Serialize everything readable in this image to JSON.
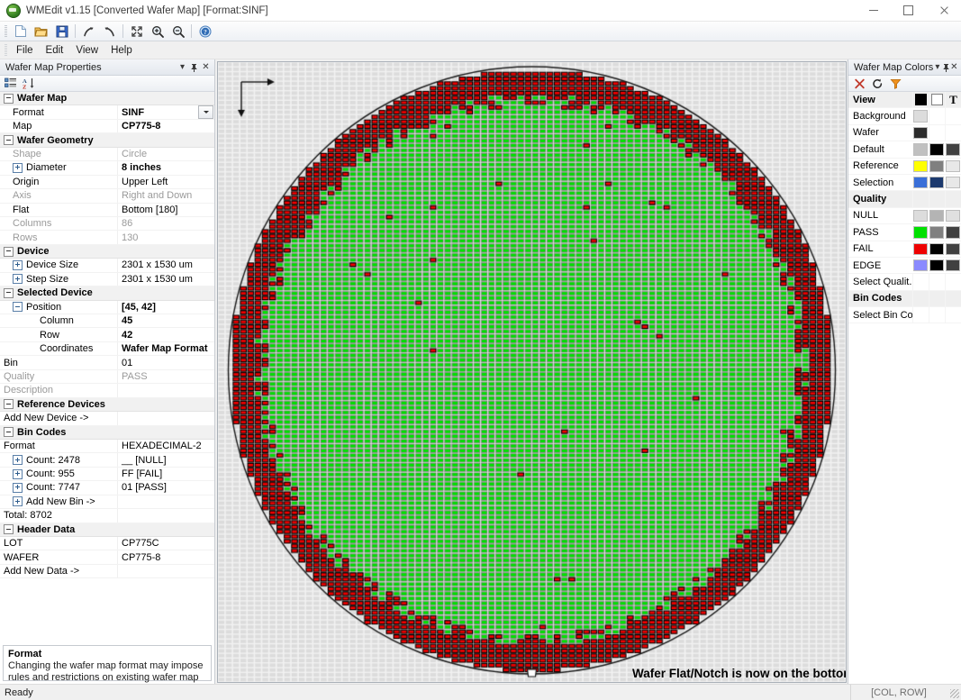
{
  "window": {
    "title": "WMEdit v1.15 [Converted Wafer Map] [Format:SINF]",
    "app_icon": "wafer-app-icon",
    "minimize": "minimize-icon",
    "maximize": "maximize-icon",
    "close": "close-icon"
  },
  "toolbar": {
    "items": [
      {
        "name": "new-file-icon",
        "label": "New"
      },
      {
        "name": "open-folder-icon",
        "label": "Open"
      },
      {
        "name": "save-icon",
        "label": "Save"
      },
      {
        "name": "redo-icon",
        "label": "Redo"
      },
      {
        "name": "undo-icon",
        "label": "Undo"
      },
      {
        "name": "fit-to-window-icon",
        "label": "Fit"
      },
      {
        "name": "zoom-in-icon",
        "label": "Zoom In"
      },
      {
        "name": "zoom-out-icon",
        "label": "Zoom Out"
      },
      {
        "name": "help-icon",
        "label": "Help"
      }
    ]
  },
  "menubar": {
    "items": [
      "File",
      "Edit",
      "View",
      "Help"
    ]
  },
  "properties_panel": {
    "title": "Wafer Map Properties",
    "header_buttons": [
      "dropdown-icon",
      "pin-icon",
      "close-icon"
    ],
    "toolbar_buttons": [
      "categorized-sort-icon",
      "alphabetical-sort-icon"
    ],
    "rows": [
      {
        "kind": "category",
        "name": "Wafer Map",
        "value": "",
        "indent": 0,
        "expander": "minus"
      },
      {
        "kind": "prop",
        "name": "Format",
        "value": "SINF",
        "indent": 1,
        "bold": true,
        "combo": true
      },
      {
        "kind": "prop",
        "name": "Map",
        "value": "CP775-8",
        "indent": 1,
        "bold": true
      },
      {
        "kind": "category",
        "name": "Wafer Geometry",
        "value": "",
        "indent": 0,
        "expander": "minus"
      },
      {
        "kind": "prop",
        "name": "Shape",
        "value": "Circle",
        "indent": 1,
        "dim": true
      },
      {
        "kind": "prop",
        "name": "Diameter",
        "value": "8 inches",
        "indent": 1,
        "bold": true,
        "expander": "plus-blue"
      },
      {
        "kind": "prop",
        "name": "Origin",
        "value": "Upper Left",
        "indent": 1
      },
      {
        "kind": "prop",
        "name": "Axis",
        "value": "Right and Down",
        "indent": 1,
        "dim": true
      },
      {
        "kind": "prop",
        "name": "Flat",
        "value": "Bottom [180]",
        "indent": 1
      },
      {
        "kind": "prop",
        "name": "Columns",
        "value": "86",
        "indent": 1,
        "dim": true
      },
      {
        "kind": "prop",
        "name": "Rows",
        "value": "130",
        "indent": 1,
        "dim": true
      },
      {
        "kind": "category",
        "name": "Device",
        "value": "",
        "indent": 0,
        "expander": "minus"
      },
      {
        "kind": "prop",
        "name": "Device Size",
        "value": "2301 x 1530 um",
        "indent": 1,
        "expander": "plus-blue"
      },
      {
        "kind": "prop",
        "name": "Step Size",
        "value": "2301 x 1530 um",
        "indent": 1,
        "expander": "plus-blue"
      },
      {
        "kind": "category",
        "name": "Selected Device",
        "value": "",
        "indent": 0,
        "expander": "minus"
      },
      {
        "kind": "prop",
        "name": "Position",
        "value": "[45, 42]",
        "indent": 1,
        "bold": true,
        "expander": "minus-blue"
      },
      {
        "kind": "prop",
        "name": "Column",
        "value": "45",
        "indent": 3,
        "bold": true
      },
      {
        "kind": "prop",
        "name": "Row",
        "value": "42",
        "indent": 3,
        "bold": true
      },
      {
        "kind": "prop",
        "name": "Coordinates",
        "value": "Wafer Map Format",
        "indent": 3,
        "bold": true
      },
      {
        "kind": "prop",
        "name": "Bin",
        "value": "01",
        "indent": 0
      },
      {
        "kind": "prop",
        "name": "Quality",
        "value": "PASS",
        "indent": 0,
        "dim": true
      },
      {
        "kind": "prop",
        "name": "Description",
        "value": "",
        "indent": 0,
        "dim": true
      },
      {
        "kind": "category",
        "name": "Reference Devices",
        "value": "",
        "indent": 0,
        "expander": "minus"
      },
      {
        "kind": "prop",
        "name": "Add New Device ->",
        "value": "",
        "indent": 0
      },
      {
        "kind": "category",
        "name": "Bin Codes",
        "value": "",
        "indent": 0,
        "expander": "minus"
      },
      {
        "kind": "prop",
        "name": "Format",
        "value": "HEXADECIMAL-2",
        "indent": 0
      },
      {
        "kind": "prop",
        "name": "Count: 2478",
        "value": "__ [NULL]",
        "indent": 1,
        "expander": "plus-blue"
      },
      {
        "kind": "prop",
        "name": "Count: 955",
        "value": "FF [FAIL]",
        "indent": 1,
        "expander": "plus-blue"
      },
      {
        "kind": "prop",
        "name": "Count: 7747",
        "value": "01 [PASS]",
        "indent": 1,
        "expander": "plus-blue"
      },
      {
        "kind": "prop",
        "name": "Add New Bin ->",
        "value": "",
        "indent": 1,
        "expander": "plus-blue"
      },
      {
        "kind": "prop",
        "name": "Total: 8702",
        "value": "",
        "indent": 0
      },
      {
        "kind": "category",
        "name": "Header Data",
        "value": "",
        "indent": 0,
        "expander": "minus"
      },
      {
        "kind": "prop",
        "name": "LOT",
        "value": "CP775C",
        "indent": 0
      },
      {
        "kind": "prop",
        "name": "WAFER",
        "value": "CP775-8",
        "indent": 0
      },
      {
        "kind": "prop",
        "name": "Add New Data ->",
        "value": "",
        "indent": 0
      }
    ],
    "description": {
      "title": "Format",
      "text": "Changing the wafer map format may impose rules and restrictions on existing wafer map properties."
    }
  },
  "colors_panel": {
    "title": "Wafer Map Colors",
    "header_buttons": [
      "dropdown-icon",
      "pin-icon",
      "close-icon"
    ],
    "toolbar_buttons": [
      "delete-icon",
      "reset-icon",
      "filter-icon"
    ],
    "column_glyphs": [
      "fill-color-icon",
      "border-color-icon",
      "text-color-icon"
    ],
    "rows": [
      {
        "kind": "header",
        "label": "View",
        "swatches": []
      },
      {
        "kind": "item",
        "label": "Background",
        "swatches": [
          "#dcdcdc",
          null,
          null
        ]
      },
      {
        "kind": "item",
        "label": "Wafer",
        "swatches": [
          "#2b2b2b",
          null,
          null
        ]
      },
      {
        "kind": "item",
        "label": "Default",
        "swatches": [
          "#c0c0c0",
          "#000000",
          "#404040"
        ]
      },
      {
        "kind": "item",
        "label": "Reference",
        "swatches": [
          "#ffff00",
          "#808080",
          "#e8e8e8"
        ]
      },
      {
        "kind": "item",
        "label": "Selection",
        "swatches": [
          "#3a6fd8",
          "#1d3a6e",
          "#e8e8e8"
        ]
      },
      {
        "kind": "header",
        "label": "Quality",
        "swatches": []
      },
      {
        "kind": "item",
        "label": "NULL",
        "swatches": [
          "#dcdcdc",
          "#b4b4b4",
          "#e0e0e0"
        ]
      },
      {
        "kind": "item",
        "label": "PASS",
        "swatches": [
          "#00e000",
          "#808080",
          "#404040"
        ]
      },
      {
        "kind": "item",
        "label": "FAIL",
        "swatches": [
          "#ee0000",
          "#000000",
          "#404040"
        ]
      },
      {
        "kind": "item",
        "label": "EDGE",
        "swatches": [
          "#8a8aff",
          "#000000",
          "#404040"
        ]
      },
      {
        "kind": "item",
        "label": "Select Qualit...",
        "swatches": [
          null,
          null,
          null
        ]
      },
      {
        "kind": "header",
        "label": "Bin Codes",
        "swatches": []
      },
      {
        "kind": "item",
        "label": "Select Bin Co...",
        "swatches": [
          null,
          null,
          null
        ]
      }
    ]
  },
  "canvas": {
    "axis_indicator": "axis-right-down-icon",
    "overlay_message": "Wafer Flat/Notch is now on the bottom",
    "notch_marker": "wafer-notch-icon"
  },
  "statusbar": {
    "message": "Ready",
    "coordinates": "[COL, ROW]",
    "resize_grip": "resize-grip-icon"
  },
  "wafer_map": {
    "columns": 86,
    "rows": 130,
    "diameter": "8 inches",
    "flat": "Bottom [180]",
    "origin": "Upper Left",
    "counts": {
      "null": 2478,
      "fail": 955,
      "pass": 7747,
      "total": 8702
    },
    "colors": {
      "pass_fill": "#00e000",
      "pass_border": "#808080",
      "fail_fill": "#ee0000",
      "fail_border": "#000000",
      "null_fill": "#dcdcdc",
      "null_border": "#cfcfcf",
      "background": "#e9e9e9",
      "wafer_outline": "#1a1a1a"
    }
  }
}
